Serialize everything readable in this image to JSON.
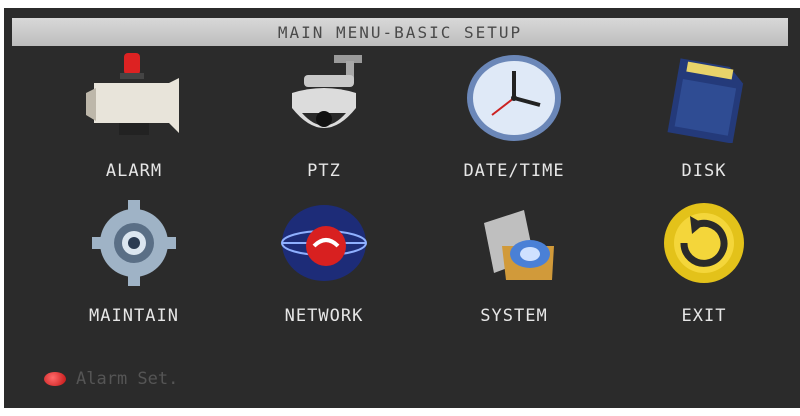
{
  "title": "MAIN MENU-BASIC SETUP",
  "menu": [
    {
      "label": "ALARM",
      "icon": "siren-icon"
    },
    {
      "label": "PTZ",
      "icon": "dome-camera-icon"
    },
    {
      "label": "DATE/TIME",
      "icon": "clock-icon"
    },
    {
      "label": "DISK",
      "icon": "sd-card-icon"
    },
    {
      "label": "MAINTAIN",
      "icon": "gear-icon"
    },
    {
      "label": "NETWORK",
      "icon": "network-globe-icon"
    },
    {
      "label": "SYSTEM",
      "icon": "system-settings-icon"
    },
    {
      "label": "EXIT",
      "icon": "exit-icon"
    }
  ],
  "status_text": "Alarm Set.",
  "colors": {
    "background": "#2b2b2b",
    "title_bar": "#c8c8c8",
    "label": "#e6e6e6",
    "status": "#555555"
  }
}
